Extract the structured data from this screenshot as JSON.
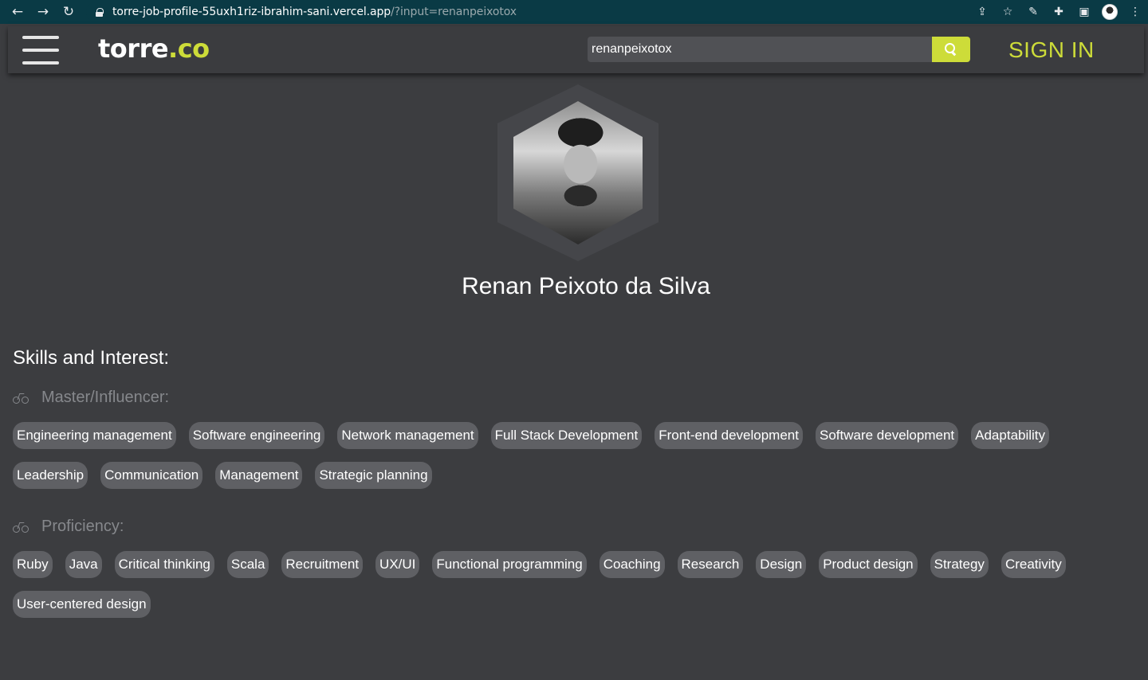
{
  "browser": {
    "url_host": "torre-job-profile-55uxh1riz-ibrahim-sani.vercel.app",
    "url_path": "/?input=renanpeixotox"
  },
  "header": {
    "logo_main": "torre",
    "logo_accent": ".co",
    "search_value": "renanpeixotox",
    "sign_in_label": "SIGN IN",
    "accent_color": "#cddc39"
  },
  "profile": {
    "name": "Renan Peixoto da Silva"
  },
  "skills": {
    "title": "Skills and Interest:",
    "master": {
      "label": "Master/Influencer:",
      "items": [
        "Engineering management",
        "Software engineering",
        "Network management",
        "Full Stack Development",
        "Front-end development",
        "Software development",
        "Adaptability",
        "Leadership",
        "Communication",
        "Management",
        "Strategic planning"
      ]
    },
    "proficiency": {
      "label": "Proficiency:",
      "items": [
        "Ruby",
        "Java",
        "Critical thinking",
        "Scala",
        "Recruitment",
        "UX/UI",
        "Functional programming",
        "Coaching",
        "Research",
        "Design",
        "Product design",
        "Strategy",
        "Creativity",
        "User-centered design"
      ]
    }
  }
}
